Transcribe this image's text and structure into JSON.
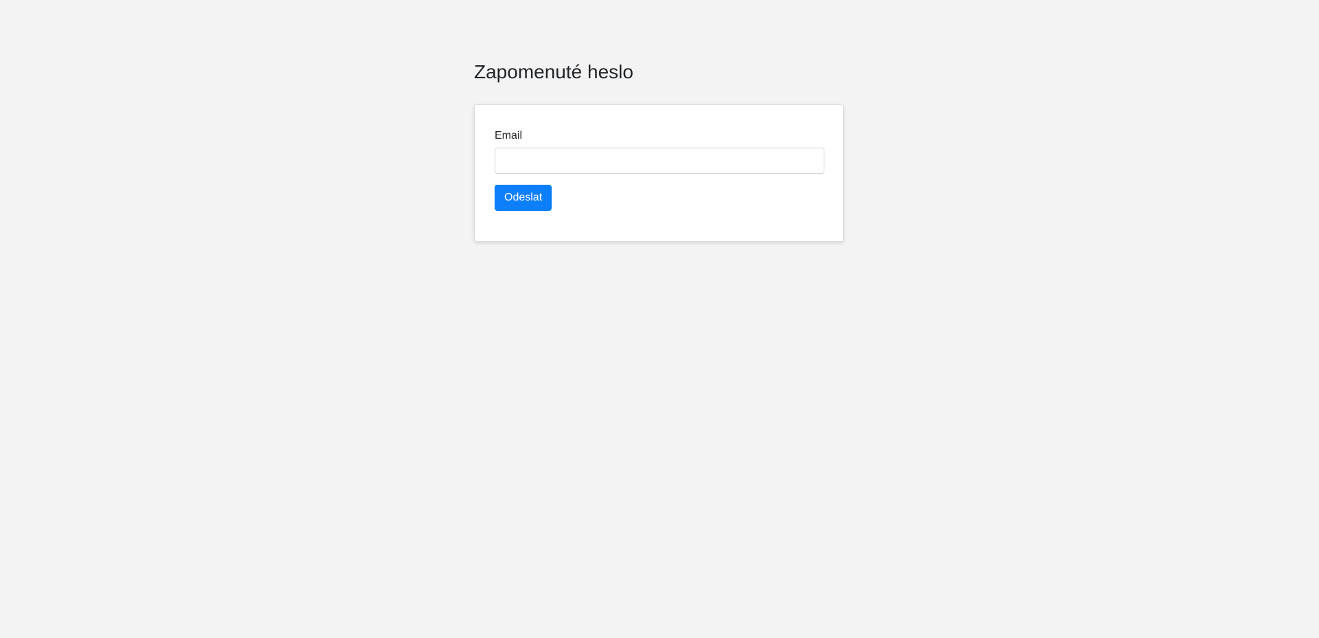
{
  "page": {
    "title": "Zapomenuté heslo"
  },
  "form": {
    "email_label": "Email",
    "email_value": "",
    "email_placeholder": "",
    "submit_label": "Odeslat"
  },
  "colors": {
    "background": "#f3f3f3",
    "card": "#ffffff",
    "primary": "#0d7ffb",
    "text": "#212529"
  }
}
